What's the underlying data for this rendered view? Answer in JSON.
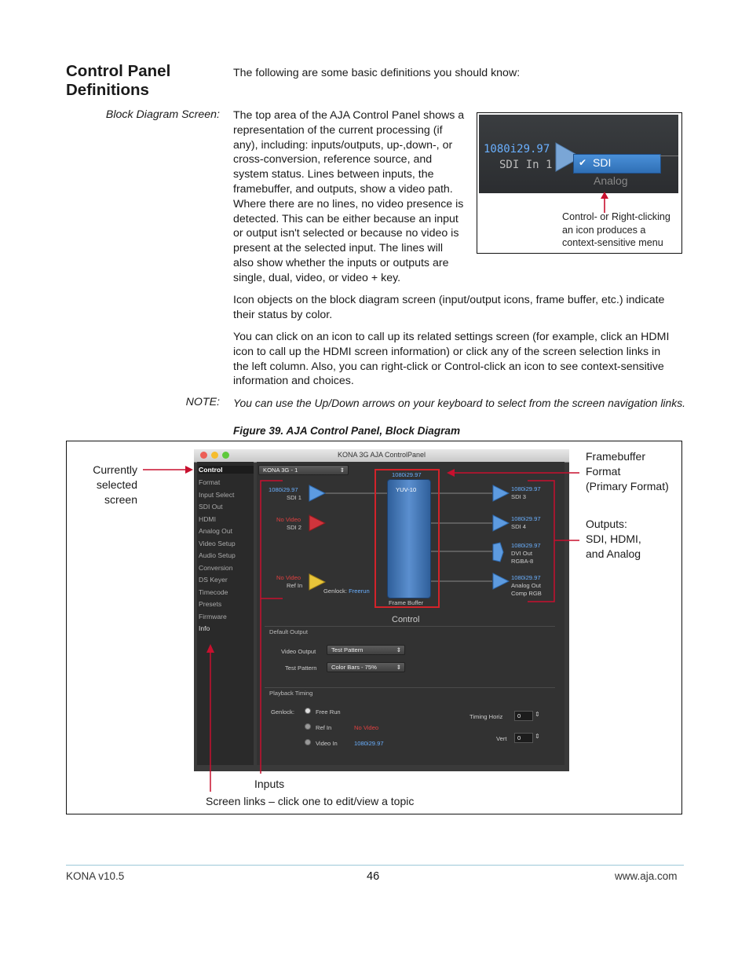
{
  "section": {
    "title_line1": "Control Panel",
    "title_line2": "Definitions",
    "intro": "The following are some basic definitions you should know:"
  },
  "block_diagram": {
    "label": "Block Diagram Screen:",
    "lines": [
      "The top area of the AJA Control Panel shows a",
      "representation of the current processing (if",
      "any), including: inputs/outputs, up-,down-, or",
      "cross-conversion, reference source, and",
      "system status. Lines between inputs, the",
      "framebuffer, and outputs, show a video path.",
      "Where there are no lines, no video presence is",
      "detected. This can be either because an input",
      "or output isn't selected or because no video is",
      "present at the selected input. The lines will",
      "also show whether the inputs or outputs are",
      "single, dual, video, or video + key."
    ]
  },
  "inset": {
    "format": "1080i29.97",
    "input": "SDI In 1",
    "menu_checked": "SDI",
    "menu_other": "Analog",
    "caption_lines": [
      "Control- or Right-clicking",
      "an icon produces a",
      "context-sensitive menu"
    ]
  },
  "paragraph2": [
    "Icon objects on the block diagram screen (input/output icons, frame buffer, etc.) indicate",
    "their status by color."
  ],
  "paragraph3": [
    "You can click on an icon to call up its related settings screen (for example, click an HDMI",
    "icon to call up the HDMI screen information) or click any of the screen selection links in",
    "the left column. Also, you can right-click or Control-click an icon to see context-sensitive",
    "information and choices."
  ],
  "note": {
    "label": "NOTE:",
    "text": "You can use the Up/Down arrows on your keyboard to select from the screen navigation links."
  },
  "figure": {
    "title": "Figure 39. AJA Control Panel, Block Diagram",
    "callouts": {
      "selected": [
        "Currently",
        "selected",
        "screen"
      ],
      "framebuffer": [
        "Framebuffer",
        "Format",
        "(Primary Format)"
      ],
      "outputs": [
        "Outputs:",
        "SDI, HDMI,",
        "and Analog"
      ],
      "inputs": "Inputs",
      "screen_links": "Screen links – click one to edit/view a topic"
    },
    "app": {
      "window_title": "KONA 3G AJA ControlPanel",
      "device": "KONA 3G - 1",
      "nav": [
        "Control",
        "Format",
        "Input Select",
        "SDI Out",
        "HDMI",
        "Analog Out",
        "Video Setup",
        "Audio Setup",
        "Conversion",
        "DS Keyer",
        "Timecode",
        "Presets",
        "Firmware",
        "Info"
      ],
      "in1_fmt": "1080i29.97",
      "in1_name": "SDI 1",
      "in2_fmt": "No Video",
      "in2_name": "SDI 2",
      "ref_fmt": "No Video",
      "ref_name": "Ref In",
      "genlock_label": "Genlock:",
      "genlock_value": "Freerun",
      "fb_format": "1080i29.97",
      "fb_pixel": "YUV-10",
      "fb_label": "Frame Buffer",
      "out1_fmt": "1080i29.97",
      "out1_name": "SDI 3",
      "out2_fmt": "1080i29.97",
      "out2_name": "SDI 4",
      "out3_fmt": "1080i29.97",
      "out3_name": "DVI Out",
      "out3_sub": "RGBA-8",
      "out4_fmt": "1080i29.97",
      "out4_name": "Analog Out",
      "out4_sub": "Comp RGB",
      "screen_name": "Control",
      "default_output": "Default Output",
      "video_output_label": "Video Output",
      "video_output_value": "Test Pattern",
      "test_pattern_label": "Test Pattern",
      "test_pattern_value": "Color Bars - 75%",
      "playback_timing": "Playback Timing",
      "genlock2": "Genlock:",
      "free_run": "Free Run",
      "ref_in": "Ref In",
      "ref_in_status": "No Video",
      "video_in": "Video In",
      "video_in_status": "1080i29.97",
      "timing_horiz": "Timing Horiz",
      "horiz_value": "0",
      "vert": "Vert",
      "vert_value": "0"
    }
  },
  "footer": {
    "left": "KONA v10.5",
    "page": "46",
    "right": "www.aja.com"
  }
}
